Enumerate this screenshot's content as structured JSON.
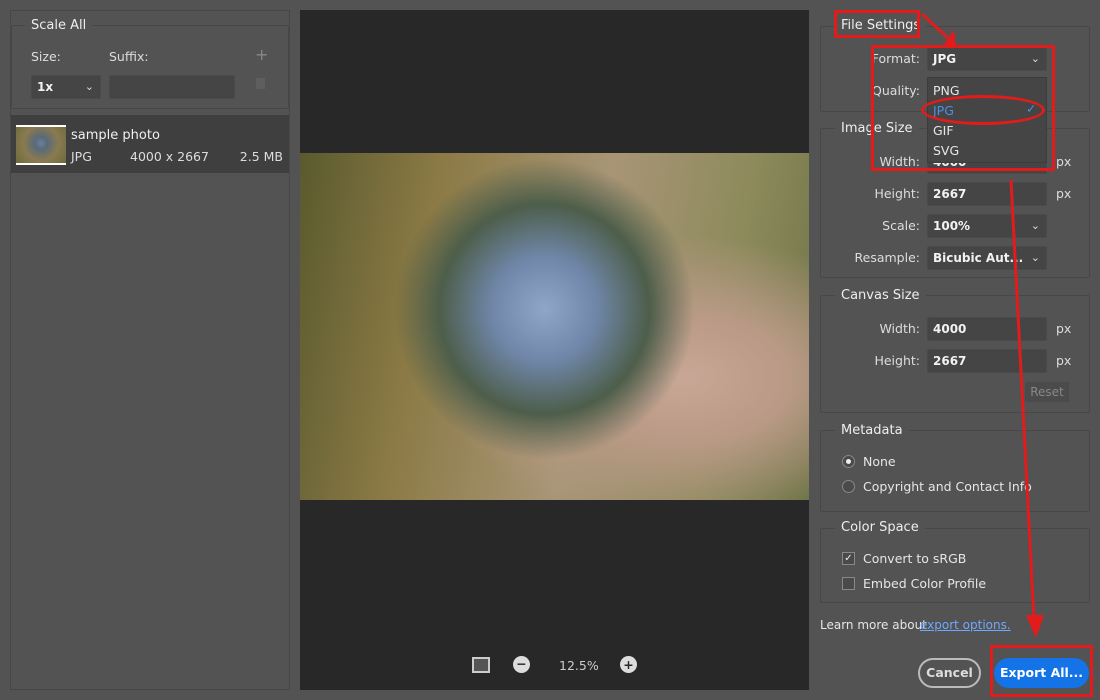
{
  "scale_all": {
    "title": "Scale All",
    "size_label": "Size:",
    "suffix_label": "Suffix:",
    "size_value": "1x",
    "suffix_value": "",
    "add_icon": "plus-icon",
    "delete_icon": "trash-icon"
  },
  "asset": {
    "name": "sample photo",
    "format": "JPG",
    "dimensions": "4000 x 2667",
    "size": "2.5 MB"
  },
  "preview": {
    "zoom": "12.5%"
  },
  "file_settings": {
    "title": "File Settings",
    "format_label": "Format:",
    "format_value": "JPG",
    "quality_label": "Quality:",
    "options": [
      "PNG",
      "JPG",
      "GIF",
      "SVG"
    ],
    "selected": "JPG"
  },
  "image_size": {
    "title": "Image Size",
    "width_label": "Width:",
    "width_value": "4000",
    "height_label": "Height:",
    "height_value": "2667",
    "scale_label": "Scale:",
    "scale_value": "100%",
    "resample_label": "Resample:",
    "resample_value": "Bicubic Aut...",
    "unit": "px"
  },
  "canvas_size": {
    "title": "Canvas Size",
    "width_label": "Width:",
    "width_value": "4000",
    "height_label": "Height:",
    "height_value": "2667",
    "unit": "px",
    "reset": "Reset"
  },
  "metadata": {
    "title": "Metadata",
    "options": [
      "None",
      "Copyright and Contact Info"
    ],
    "selected": "None"
  },
  "color_space": {
    "title": "Color Space",
    "convert": "Convert to sRGB",
    "convert_checked": true,
    "embed": "Embed Color Profile",
    "embed_checked": false
  },
  "footer": {
    "learn_text": "Learn more about",
    "learn_link": "export options.",
    "cancel": "Cancel",
    "export": "Export All..."
  },
  "colors": {
    "accent": "#1473e6",
    "annotation": "#e31b1b",
    "link": "#6ea8ff"
  }
}
